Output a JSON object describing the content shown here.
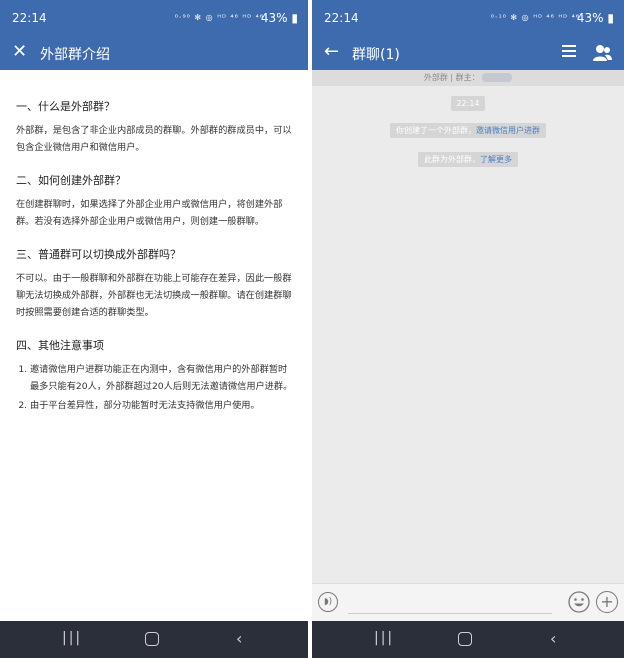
{
  "left": {
    "status": {
      "time": "22:14",
      "icons": "⁰·⁹⁰ ✻ ◎ ᴴᴰ ⁴⁶ ᴴᴰ ⁴⁶",
      "battery": "43% ▮"
    },
    "header": {
      "title": "外部群介绍",
      "close_icon": "close-icon"
    },
    "sections": [
      {
        "heading": "一、什么是外部群？",
        "body": "外部群，是包含了非企业内部成员的群聊。外部群的群成员中，可以包含企业微信用户和微信用户。"
      },
      {
        "heading": "二、如何创建外部群？",
        "body": "在创建群聊时，如果选择了外部企业用户或微信用户，将创建外部群。若没有选择外部企业用户或微信用户，则创建一般群聊。"
      },
      {
        "heading": "三、普通群可以切换成外部群吗？",
        "body": "不可以。由于一般群聊和外部群在功能上可能存在差异，因此一般群聊无法切换成外部群，外部群也无法切换成一般群聊。请在创建群聊时按照需要创建合适的群聊类型。"
      },
      {
        "heading": "四、其他注意事项",
        "items": [
          "邀请微信用户进群功能正在内测中，含有微信用户的外部群暂时最多只能有20人，外部群超过20人后则无法邀请微信用户进群。",
          "由于平台差异性，部分功能暂时无法支持微信用户使用。"
        ]
      }
    ]
  },
  "right": {
    "status": {
      "time": "22:14",
      "icons": "⁰·¹⁰ ✻ ◎ ᴴᴰ ⁴⁶ ᴴᴰ ⁴⁶",
      "battery": "43% ▮"
    },
    "header": {
      "title": "群聊(1)",
      "back_icon": "back-arrow-icon",
      "menu_icon": "menu-icon",
      "members_icon": "group-members-icon"
    },
    "info_bar": {
      "text": "外部群 | 群主："
    },
    "messages": {
      "time": "22:14",
      "system1_prefix": "你创建了一个外部群，",
      "system1_link": "邀请微信用户进群",
      "system2_prefix": "此群为外部群，",
      "system2_link": "了解更多"
    },
    "composer": {
      "voice_icon": "voice-icon",
      "emoji_icon": "emoji-icon",
      "plus_icon": "plus-icon"
    }
  },
  "navbar": {
    "recent": "|||",
    "home": "home-icon",
    "back": "‹"
  }
}
